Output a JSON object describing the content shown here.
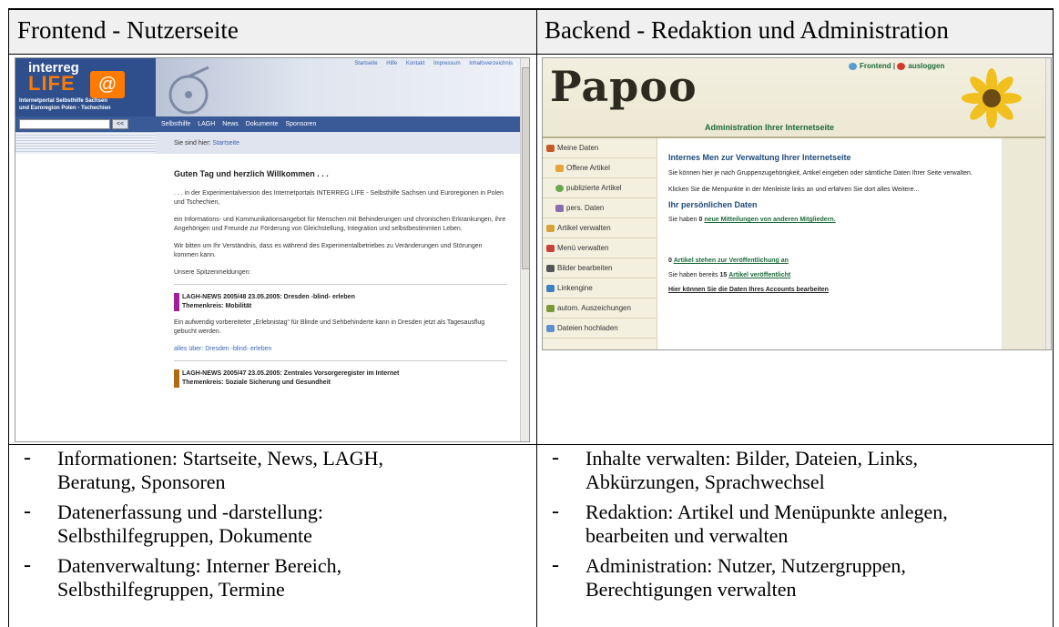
{
  "table": {
    "col1_header": "Frontend - Nutzerseite",
    "col2_header": "Backend - Redaktion und Administration",
    "col1_bullets": [
      {
        "dash": "-",
        "line1": "Informationen: Startseite, News, LAGH,",
        "line2": "Beratung, Sponsoren"
      },
      {
        "dash": "-",
        "line1": "Datenerfassung und -darstellung:",
        "line2": "Selbsthilfegruppen, Dokumente"
      },
      {
        "dash": "-",
        "line1": "Datenverwaltung: Interner Bereich,",
        "line2": "Selbsthilfegruppen, Termine"
      }
    ],
    "col2_bullets": [
      {
        "dash": "-",
        "line1": "Inhalte verwalten: Bilder, Dateien, Links,",
        "line2": "Abkürzungen, Sprachwechsel"
      },
      {
        "dash": "-",
        "line1": "Redaktion: Artikel und Menüpunkte anlegen,",
        "line2": "bearbeiten und verwalten"
      },
      {
        "dash": "-",
        "line1": "Administration: Nutzer, Nutzergruppen,",
        "line2": "Berechtigungen verwalten"
      }
    ]
  },
  "frontend": {
    "logo_line1": "interreg",
    "logo_line2": "LIFE",
    "logo_sub1": "Internetportal Selbsthilfe Sachsen",
    "logo_sub2": "und Euroregion Polen - Tschechien",
    "top_links": [
      "Startseite",
      "Hilfe",
      "Kontakt",
      "Impressum",
      "Inhaltsverzeichnis"
    ],
    "search_button": "<<",
    "nav": [
      "Selbsthilfe",
      "LAGH",
      "News",
      "Dokumente",
      "Sponsoren"
    ],
    "breadcrumb_label": "Sie sind hier:",
    "breadcrumb_link": "Startseite",
    "heading": "Guten Tag und herzlich Willkommen . . .",
    "p1": ". . . in der Experimentalversion des Internetportals INTERREG LIFE - Selbsthilfe Sachsen und Euroregionen in Polen und Tschechien,",
    "p2": "ein Informations- und Kommunikationsangebot für Menschen mit Behinderungen und chronischen Erkrankungen, ihre Angehörigen und Freunde zur Förderung von Gleichstellung, Integration und selbstbestimmten Leben.",
    "p3": "Wir bitten um Ihr Verständnis, dass es während des Experimentalbetriebes zu Veränderungen und Störungen kommen kann.",
    "p4": "Unsere Spitzenmeldungen:",
    "news1_title": "LAGH-NEWS 2005/48 23.05.2005: Dresden -blind- erleben",
    "news1_topic": "Themenkreis: Mobilität",
    "news1_text": "Ein aufwendig vorbereiteter „Erlebnistag“ für Blinde und Sehbehinderte kann in Dresden jetzt als Tagesausflug gebucht werden.",
    "news1_link": "alles über: Dresden -blind- erleben",
    "news2_title": "LAGH-NEWS 2005/47 23.05.2005: Zentrales Vorsorgeregister im Internet",
    "news2_topic": "Themenkreis: Soziale Sicherung und Gesundheit",
    "colors": {
      "news1": "#a0219a",
      "news2": "#b06a12",
      "nav": "#3a5a97"
    }
  },
  "backend": {
    "logo": "Papoo",
    "subtitle": "Administration Ihrer Internetseite",
    "top_link1": "Frontend",
    "top_sep": "|",
    "top_link2": "ausloggen",
    "menu": [
      "Meine Daten",
      "Offene Artikel",
      "publizierte Artikel",
      "pers. Daten",
      "Artikel verwalten",
      "Menü verwalten",
      "Bilder bearbeiten",
      "Linkengine",
      "autom. Auszeichungen",
      "Dateien hochladen"
    ],
    "heading": "Internes Men zur Verwaltung Ihrer Internetseite",
    "p1": "Sie können hier je nach Gruppenzugehörigkeit, Artikel eingeben oder sämtliche Daten Ihrer Seite verwalten.",
    "p2": "Klicken Sie die Menpunkte in der Menleiste links an und erfahren Sie dort alles Weitere...",
    "heading2": "Ihr persönlichen Daten",
    "msg_prefix": "Sie haben",
    "msg_count": "0",
    "msg_link": "neue Mitteilungen von anderen Mitgliedern.",
    "pending_count": "0",
    "pending_link": "Artikel stehen zur Veröffentlichung an",
    "pub_prefix": "Sie haben bereits",
    "pub_count": "15",
    "pub_link": "Artikel veröffentlicht",
    "account_link": "Hier können Sie die Daten Ihres Accounts bearbeiten"
  }
}
